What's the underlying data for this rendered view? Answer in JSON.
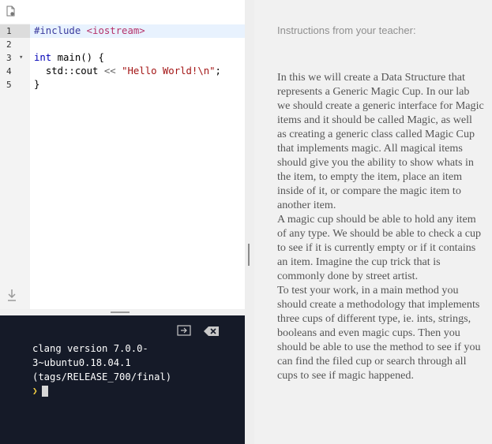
{
  "editor": {
    "line_numbers": [
      "1",
      "2",
      "3",
      "4",
      "5"
    ],
    "fold_marker": "▾",
    "code": {
      "line1_directive": "#include",
      "line1_header": "<iostream>",
      "line3_type": "int",
      "line3_rest": " main() {",
      "line4_indent": "  ",
      "line4_ns": "std::cout",
      "line4_op": " << ",
      "line4_string": "\"Hello World!\\n\"",
      "line4_end": ";",
      "line5": "}"
    }
  },
  "terminal": {
    "lines": [
      "clang version 7.0.0-",
      "3~ubuntu0.18.04.1",
      "(tags/RELEASE_700/final)"
    ],
    "prompt_symbol": "❯"
  },
  "instructions": {
    "header": "Instructions from your teacher:",
    "paragraphs": [
      "In this we will create a Data Structure that represents a Generic Magic Cup. In our lab we should create a generic interface for Magic items and it should be called Magic, as well as creating a generic class called Magic Cup that implements magic. All magical items should give you the ability to show whats in the item, to empty the item, place an item inside of it, or compare the magic item to another item.",
      "A magic cup should be able to hold any item of any type. We should be able to check a cup to see if it is currently empty or if it contains an item. Imagine the cup trick that is commonly done by street artist.",
      "To test your work, in a main method you should create a methodology that implements three cups of different type, ie. ints, strings, booleans and even magic cups. Then you should be able to use the method to see if you can find the filed cup or search through all cups to see if magic happened."
    ]
  },
  "colors": {
    "terminal_bg": "#151a28",
    "prompt": "#f5d142",
    "active_line": "#e8f2fe",
    "keyword": "#0000b7",
    "string": "#a31515"
  }
}
